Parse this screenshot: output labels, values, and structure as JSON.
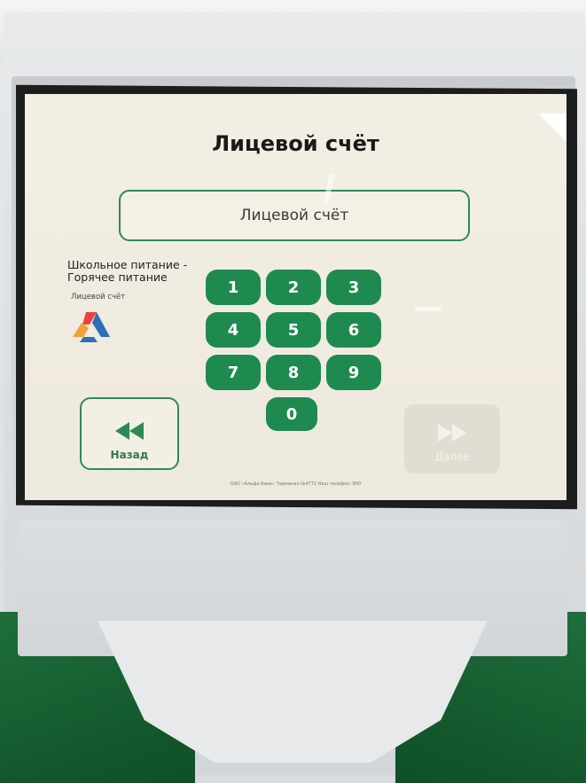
{
  "screen": {
    "title": "Лицевой счёт",
    "input": {
      "placeholder": "Лицевой счёт",
      "value": ""
    },
    "service": {
      "name": "Школьное питание - Горячее питание",
      "field_label": "Лицевой счёт",
      "logo_icon": "alfa-triangle-logo"
    },
    "keypad": {
      "keys": [
        "1",
        "2",
        "3",
        "4",
        "5",
        "6",
        "7",
        "8",
        "9",
        "0"
      ]
    },
    "buttons": {
      "back_label": "Назад",
      "back_icon": "rewind-icon",
      "next_label": "Далее",
      "next_icon": "fast-forward-icon"
    },
    "footer": "ОАО «Альфа-Банк»   Терминал №4771   Наш телефон: 800"
  },
  "colors": {
    "accent": "#1f8a4f",
    "screen_bg": "#f3efe4",
    "kiosk_green": "#0e4f27"
  }
}
